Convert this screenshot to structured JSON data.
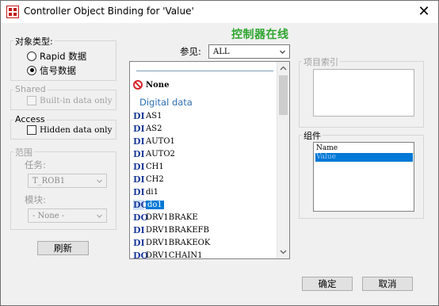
{
  "window": {
    "title": "Controller Object Binding for 'Value'",
    "close_glyph": "✕"
  },
  "online_status": "控制器在线",
  "object_type": {
    "label": "对象类型:",
    "options": [
      "Rapid 数据",
      "信号数据"
    ],
    "selected": "信号数据"
  },
  "shared": {
    "label": "Shared",
    "checkbox_label": "Built-in data only",
    "checked": false,
    "enabled": false
  },
  "access": {
    "label": "Access",
    "checkbox_label": "Hidden data only",
    "checked": false
  },
  "scope": {
    "label": "范围",
    "task_label": "任务:",
    "task_value": "T_ROB1",
    "module_label": "模块:",
    "module_value": "- None -"
  },
  "refresh_button": "刷新",
  "view": {
    "label": "参见:",
    "value": "ALL"
  },
  "signal_list": {
    "none_label": "None",
    "section_header": "Digital data",
    "items": [
      {
        "type": "DI",
        "name": "AS1"
      },
      {
        "type": "DI",
        "name": "AS2"
      },
      {
        "type": "DI",
        "name": "AUTO1"
      },
      {
        "type": "DI",
        "name": "AUTO2"
      },
      {
        "type": "DI",
        "name": "CH1"
      },
      {
        "type": "DI",
        "name": "CH2"
      },
      {
        "type": "DI",
        "name": "di1"
      },
      {
        "type": "DO",
        "name": "do1"
      },
      {
        "type": "DO",
        "name": "DRV1BRAKE"
      },
      {
        "type": "DI",
        "name": "DRV1BRAKEFB"
      },
      {
        "type": "DI",
        "name": "DRV1BRAKEOK"
      },
      {
        "type": "DO",
        "name": "DRV1CHAIN1"
      }
    ],
    "selected": "do1"
  },
  "index": {
    "label": "项目索引"
  },
  "component": {
    "label": "组件",
    "items": [
      "Name",
      "Value"
    ],
    "selected": "Value"
  },
  "ok_button": "确定",
  "cancel_button": "取消",
  "colors": {
    "online": "#2fa52f",
    "selection": "#0078d7",
    "signal_badge": "#1e3c9b",
    "section_header": "#2f6fb3"
  },
  "icons": {
    "none": "no-entry-icon",
    "app": "abb-app-icon"
  }
}
